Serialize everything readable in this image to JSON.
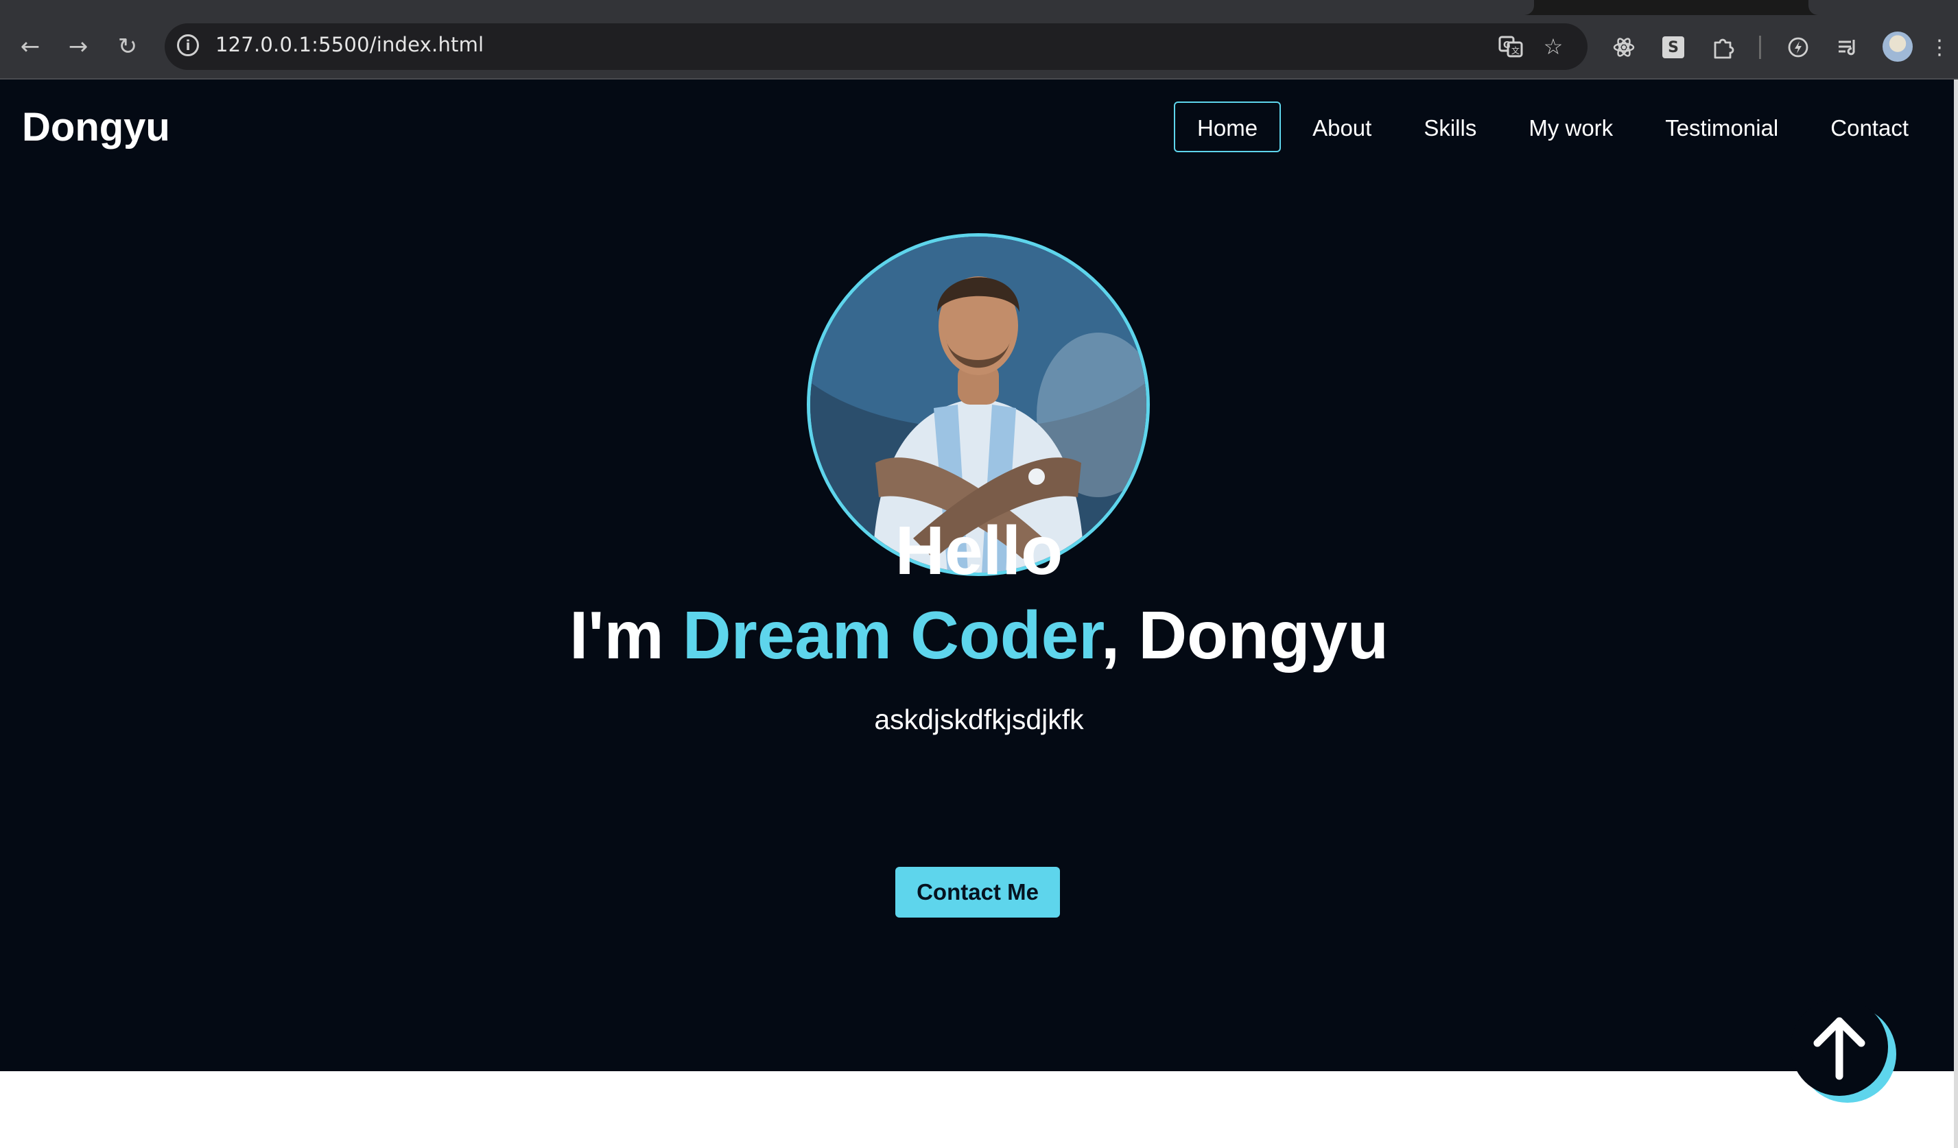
{
  "browser": {
    "url": "127.0.0.1:5500/index.html",
    "icons": {
      "back": "back-arrow-icon",
      "forward": "forward-arrow-icon",
      "reload": "reload-icon",
      "site_info": "info-icon",
      "translate": "translate-icon",
      "bookmark": "star-icon",
      "extensions": [
        "react-devtools-icon",
        "s-extension-icon",
        "puzzle-icon",
        "performance-icon",
        "reading-list-icon"
      ],
      "menu": "kebab-menu-icon"
    },
    "s_extension_label": "S"
  },
  "header": {
    "logo": "Dongyu",
    "nav": [
      {
        "label": "Home",
        "active": true
      },
      {
        "label": "About",
        "active": false
      },
      {
        "label": "Skills",
        "active": false
      },
      {
        "label": "My work",
        "active": false
      },
      {
        "label": "Testimonial",
        "active": false
      },
      {
        "label": "Contact",
        "active": false
      }
    ]
  },
  "hero": {
    "greeting": "Hello",
    "intro_prefix": "I'm ",
    "intro_highlight": "Dream Coder",
    "intro_suffix": ", Dongyu",
    "tagline": "askdjskdfkjsdjkfk",
    "cta_label": "Contact Me"
  },
  "colors": {
    "accent": "#5ed5ec",
    "page_background": "#040a14",
    "text": "#ffffff"
  }
}
